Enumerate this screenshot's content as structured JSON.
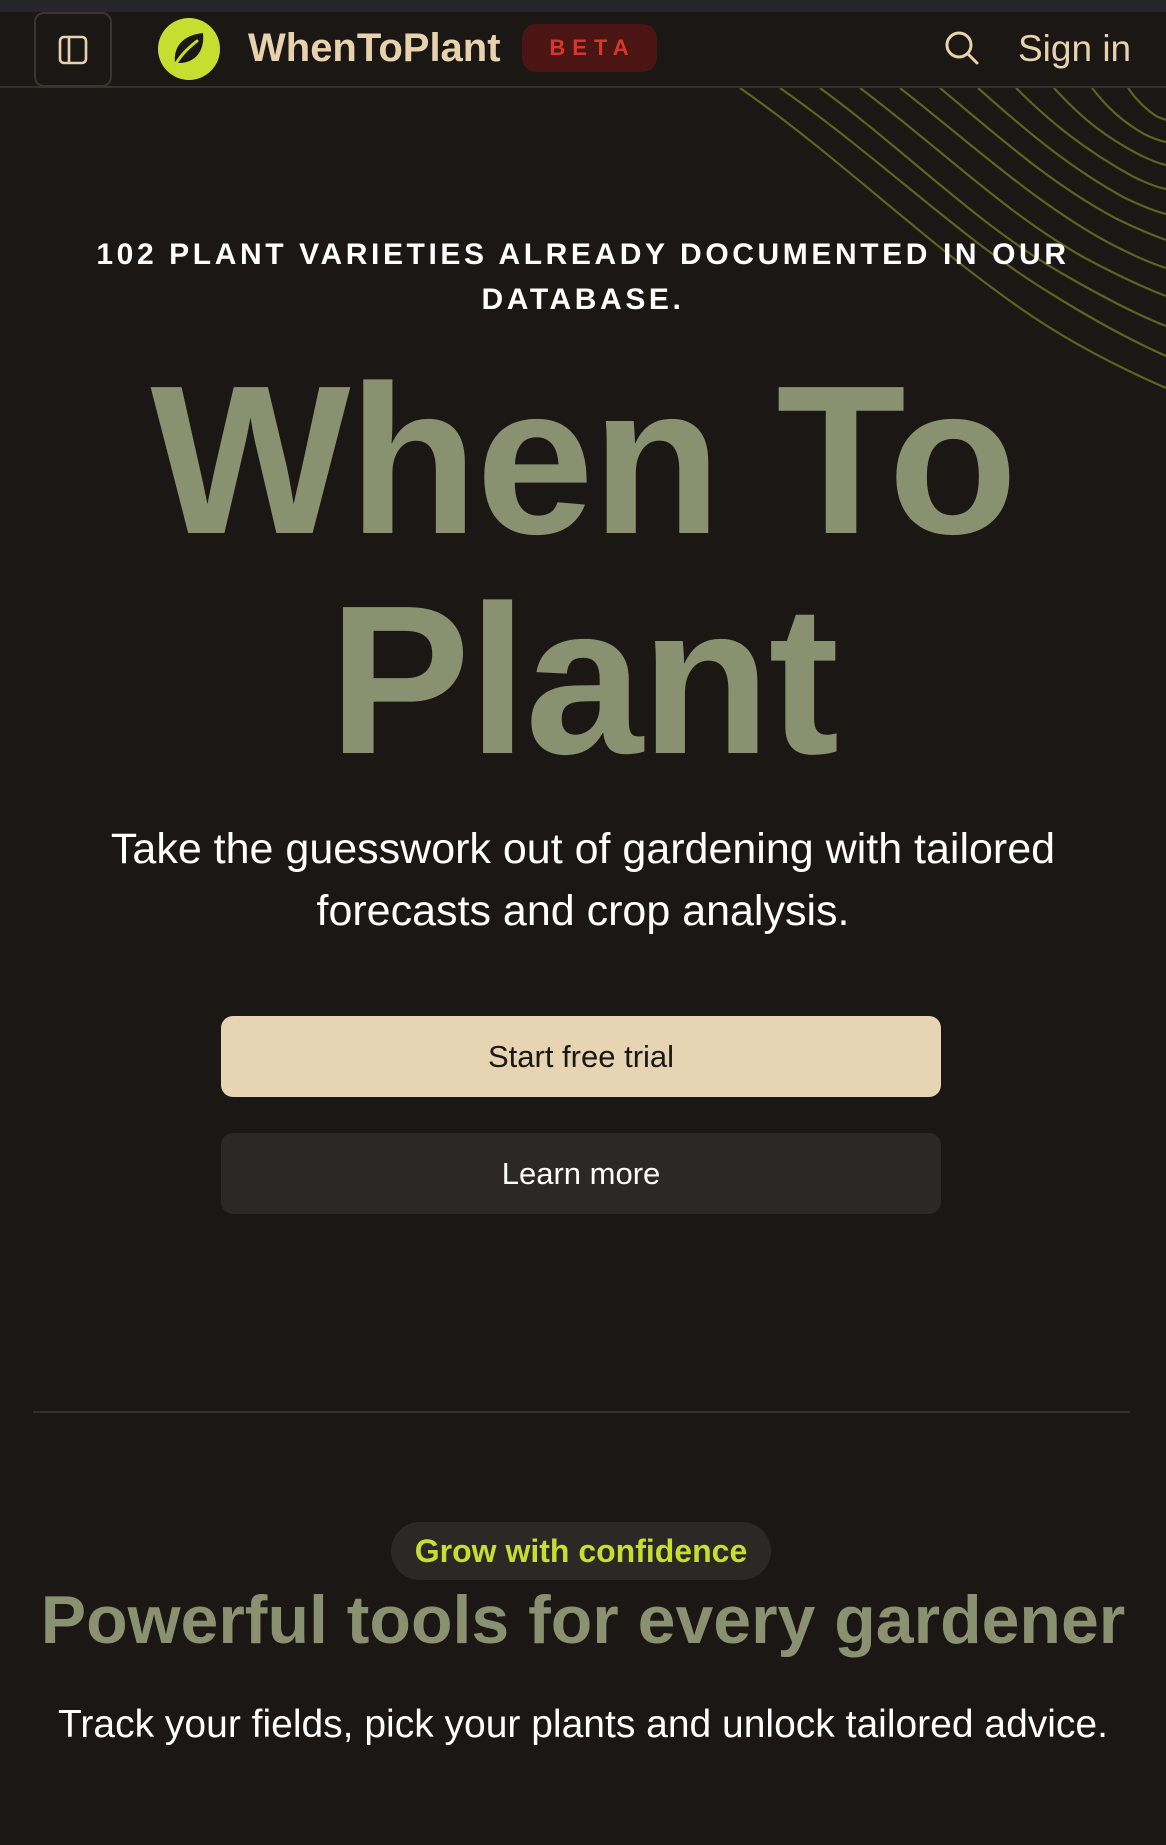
{
  "header": {
    "brand": "WhenToPlant",
    "badge": "BETA",
    "sign_in": "Sign in",
    "icons": {
      "sidebar_toggle": "sidebar-panel-icon",
      "logo": "leaf-logo-icon",
      "search": "search-icon"
    }
  },
  "hero": {
    "eyebrow_line1": "102 PLANT VARIETIES ALREADY DOCUMENTED IN OUR",
    "eyebrow_line2": "DATABASE.",
    "title_line1": "When To",
    "title_line2": "Plant",
    "subtitle_line1": "Take the guesswork out of gardening with tailored",
    "subtitle_line2": "forecasts and crop analysis.",
    "primary_cta": "Start free trial",
    "secondary_cta": "Learn more"
  },
  "features": {
    "pill": "Grow with confidence",
    "title": "Powerful tools for every gardener",
    "subtitle": "Track your fields, pick your plants and unlock tailored advice."
  },
  "colors": {
    "background": "#1a1714",
    "accent_sage": "#8a9170",
    "accent_lime": "#c5de2f",
    "accent_cream": "#e7d4b3",
    "badge_red": "#d8352c"
  }
}
